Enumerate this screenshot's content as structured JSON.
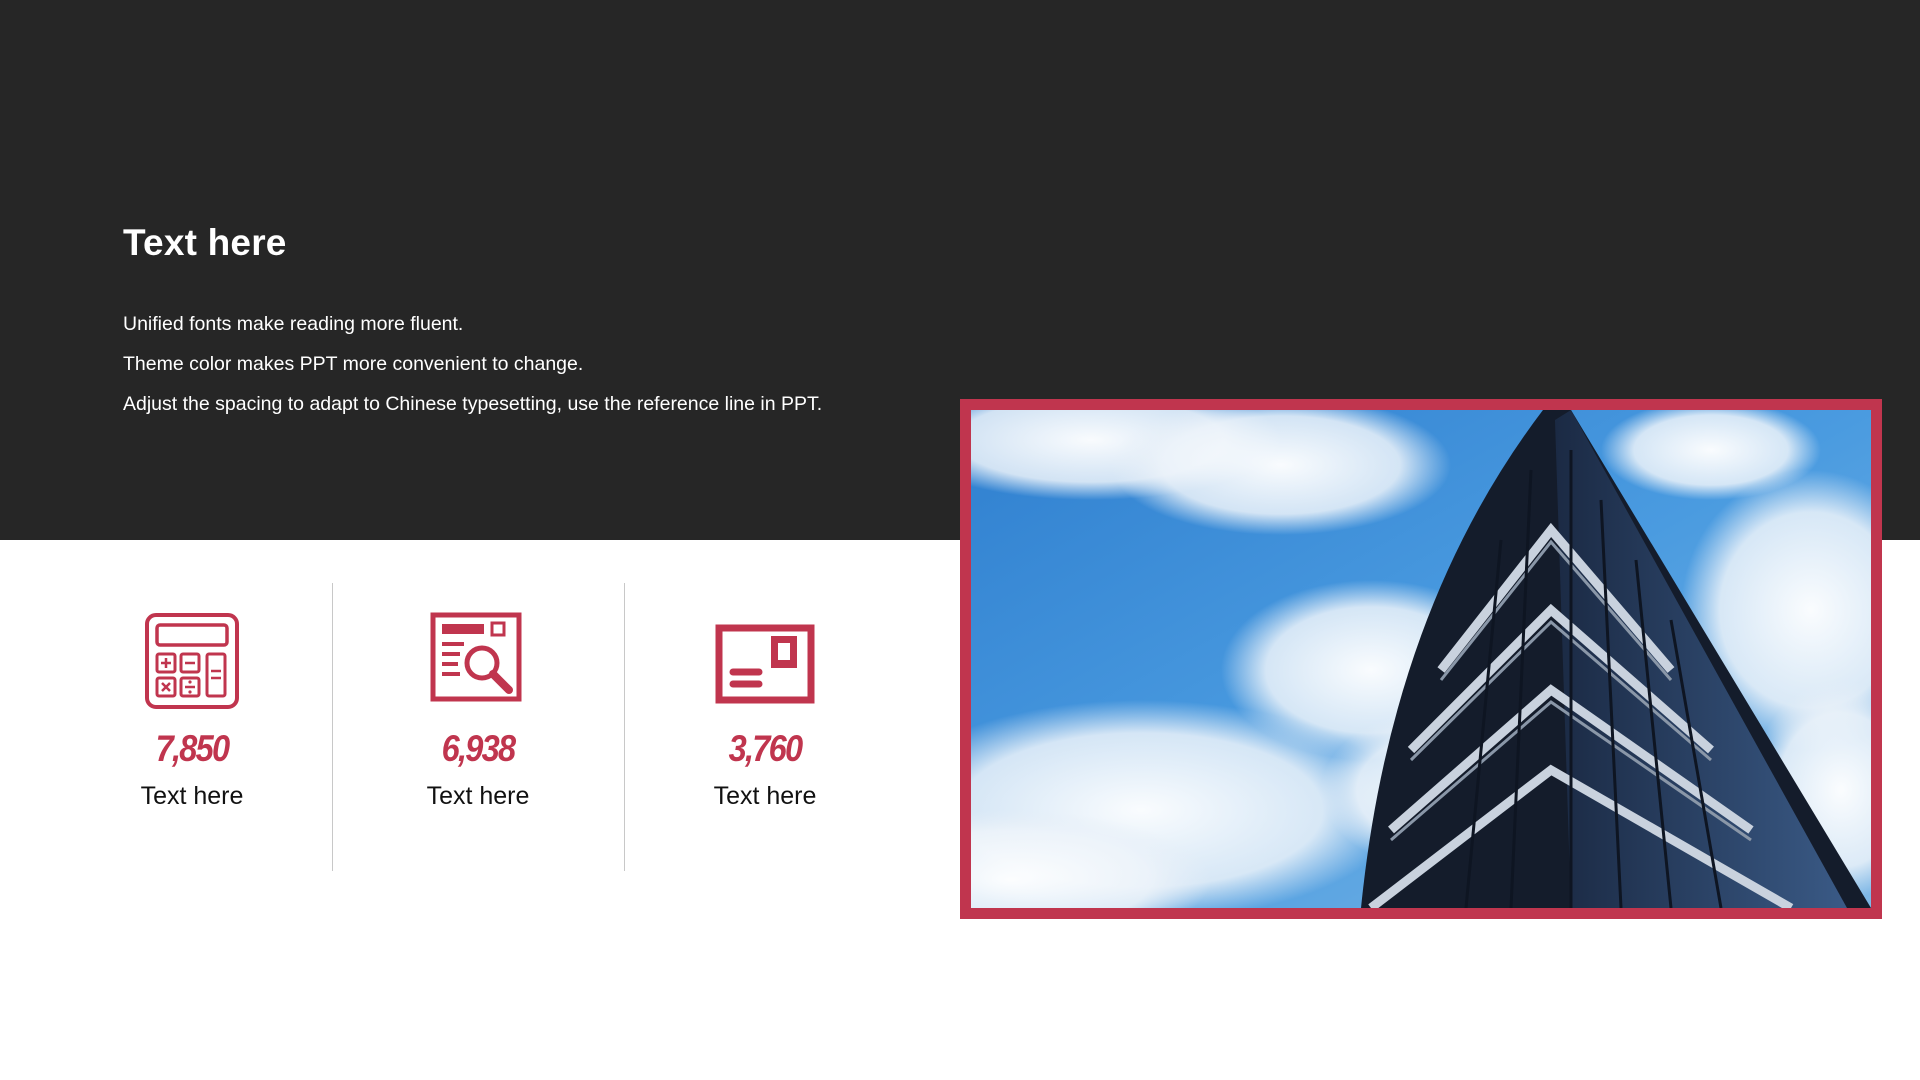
{
  "header": {
    "title": "Text here",
    "lines": [
      "Unified fonts make reading more fluent.",
      "Theme color makes PPT more convenient to change.",
      "Adjust the spacing to adapt to Chinese typesetting, use the reference line in PPT."
    ]
  },
  "stats": [
    {
      "icon": "calculator-icon",
      "value": "7,850",
      "label": "Text here"
    },
    {
      "icon": "document-search-icon",
      "value": "6,938",
      "label": "Text here"
    },
    {
      "icon": "id-card-icon",
      "value": "3,760",
      "label": "Text here"
    }
  ],
  "colors": {
    "dark_band": "#262626",
    "accent": "#c0354e",
    "sky": "#3d8fd6"
  },
  "photo": {
    "subject": "building-against-sky-image"
  }
}
